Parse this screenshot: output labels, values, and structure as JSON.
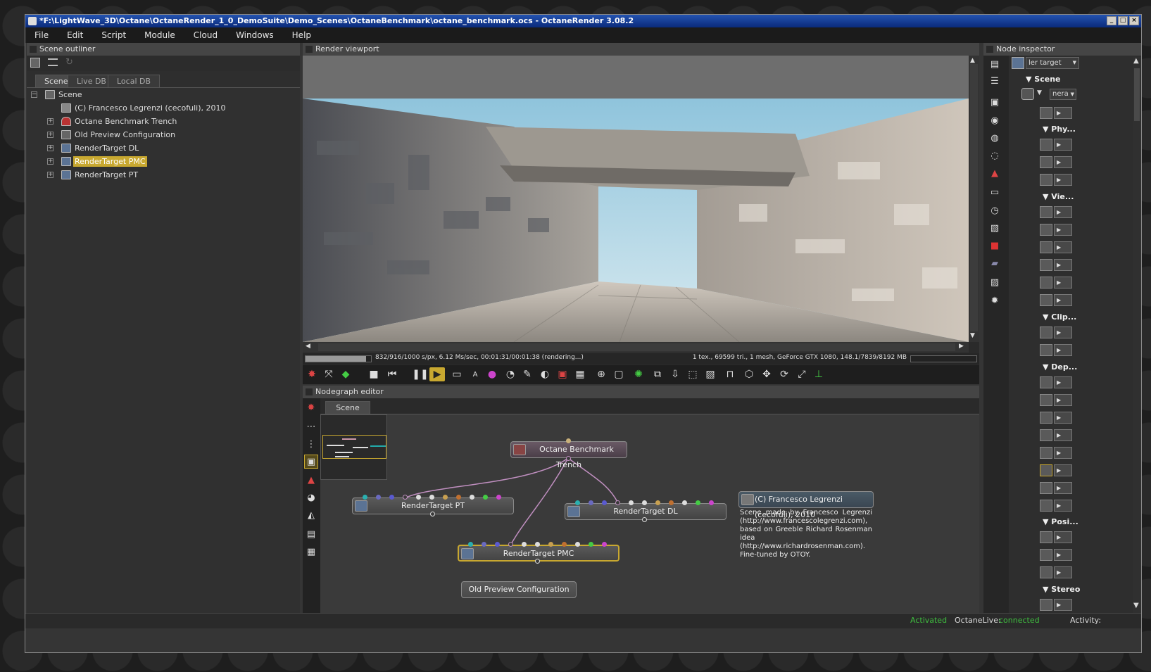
{
  "window": {
    "title": "*F:\\LightWave_3D\\Octane\\OctaneRender_1_0_DemoSuite\\Demo_Scenes\\OctaneBenchmark\\octane_benchmark.ocs - OctaneRender 3.08.2"
  },
  "menu": [
    "File",
    "Edit",
    "Script",
    "Module",
    "Cloud",
    "Windows",
    "Help"
  ],
  "outliner": {
    "title": "Scene outliner",
    "tabs": [
      "Scene",
      "Live DB",
      "Local DB"
    ],
    "items": [
      {
        "label": "Scene",
        "expander": "−"
      },
      {
        "label": "(C) Francesco Legrenzi (cecofuli), 2010",
        "expander": ""
      },
      {
        "label": "Octane Benchmark Trench",
        "expander": "+"
      },
      {
        "label": "Old Preview Configuration",
        "expander": "+"
      },
      {
        "label": "RenderTarget DL",
        "expander": "+"
      },
      {
        "label": "RenderTarget PMC",
        "expander": "+"
      },
      {
        "label": "RenderTarget PT",
        "expander": "+"
      }
    ]
  },
  "viewport": {
    "title": "Render viewport",
    "status_left": "832/916/1000 s/px, 6.12 Ms/sec, 00:01:31/00:01:38 (rendering...)",
    "status_right": "1 tex., 69599 tri., 1 mesh, GeForce GTX 1080, 148.1/7839/8192 MB",
    "progress": 0.92
  },
  "nodegraph": {
    "title": "Nodegraph editor",
    "tab": "Scene",
    "nodes": {
      "trench": "Octane Benchmark Trench",
      "pt": "RenderTarget PT",
      "dl": "RenderTarget DL",
      "pmc": "RenderTarget PMC",
      "preview": "Old Preview Configuration",
      "comment_title": "(C) Francesco Legrenzi (cecofuli), 2010",
      "comment_body": "Scene made by Francesco Legrenzi (http://www.francescolegrenzi.com), based on Greeble Richard Rosenman idea (http://www.richardrosenman.com). Fine-tuned by OTOY."
    }
  },
  "inspector": {
    "title": "Node inspector",
    "selector": "ler target",
    "camera_selector": "nera",
    "sections": [
      "Scene",
      "Phy...",
      "Vie...",
      "Clip...",
      "Dep...",
      "Posi...",
      "Stereo"
    ]
  },
  "statusbar": {
    "activated": "Activated",
    "live_label": "OctaneLive:",
    "live_status": "connected",
    "activity": "Activity:"
  },
  "colors": {
    "accent": "#c8a830",
    "connected": "#3fbf3f",
    "selection": "#c8a830"
  }
}
